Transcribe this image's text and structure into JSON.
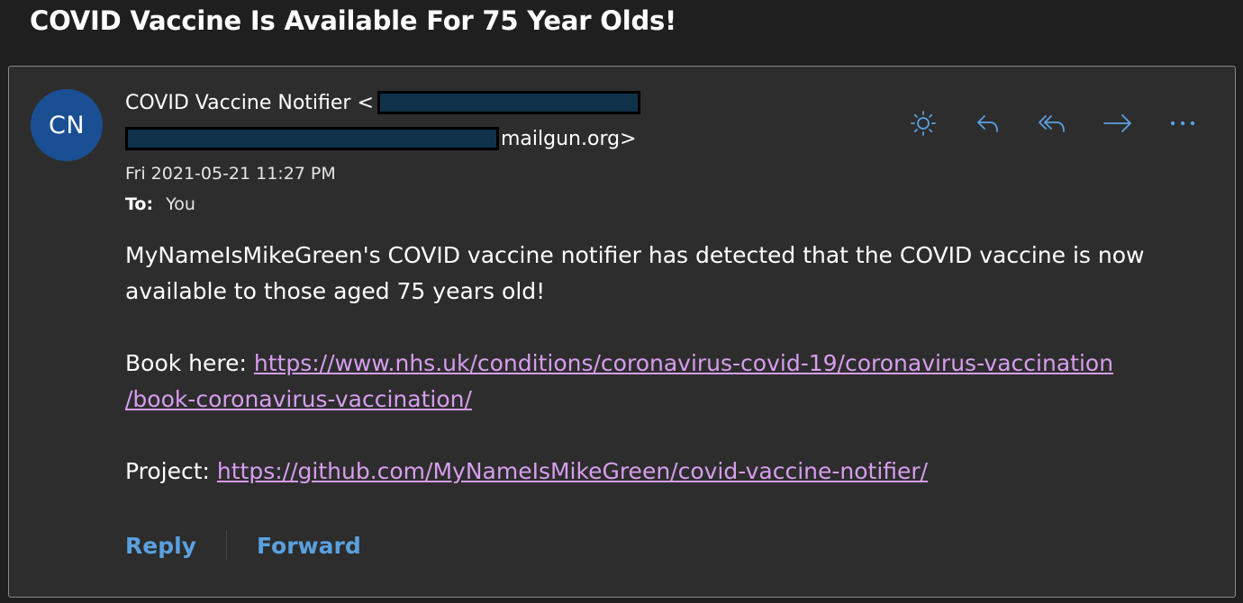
{
  "subject": "COVID Vaccine Is Available For 75 Year Olds!",
  "sender": {
    "avatar_initials": "CN",
    "avatar_color": "#1b4f93",
    "name_prefix": "COVID Vaccine Notifier <",
    "email_suffix": "mailgun.org>",
    "date": "Fri 2021-05-21 11:27 PM",
    "to_label": "To:",
    "to_value": "You"
  },
  "actions": [
    {
      "name": "sun-icon"
    },
    {
      "name": "reply-icon"
    },
    {
      "name": "reply-all-icon"
    },
    {
      "name": "forward-icon"
    },
    {
      "name": "more-icon"
    }
  ],
  "body": {
    "paragraph1": "MyNameIsMikeGreen's COVID vaccine notifier has detected that the COVID vaccine is now available to those aged 75 years old!",
    "book_label": "Book here: ",
    "book_link_line1": "https://www.nhs.uk/conditions/coronavirus-covid-19/coronavirus-vaccination",
    "book_link_line2": "/book-coronavirus-vaccination/",
    "project_label": "Project: ",
    "project_link": "https://github.com/MyNameIsMikeGreen/covid-vaccine-notifier/"
  },
  "footer": {
    "reply_label": "Reply",
    "forward_label": "Forward"
  },
  "colors": {
    "accent": "#5aa1e0",
    "link": "#d79dee",
    "redaction": "#0f3149"
  }
}
